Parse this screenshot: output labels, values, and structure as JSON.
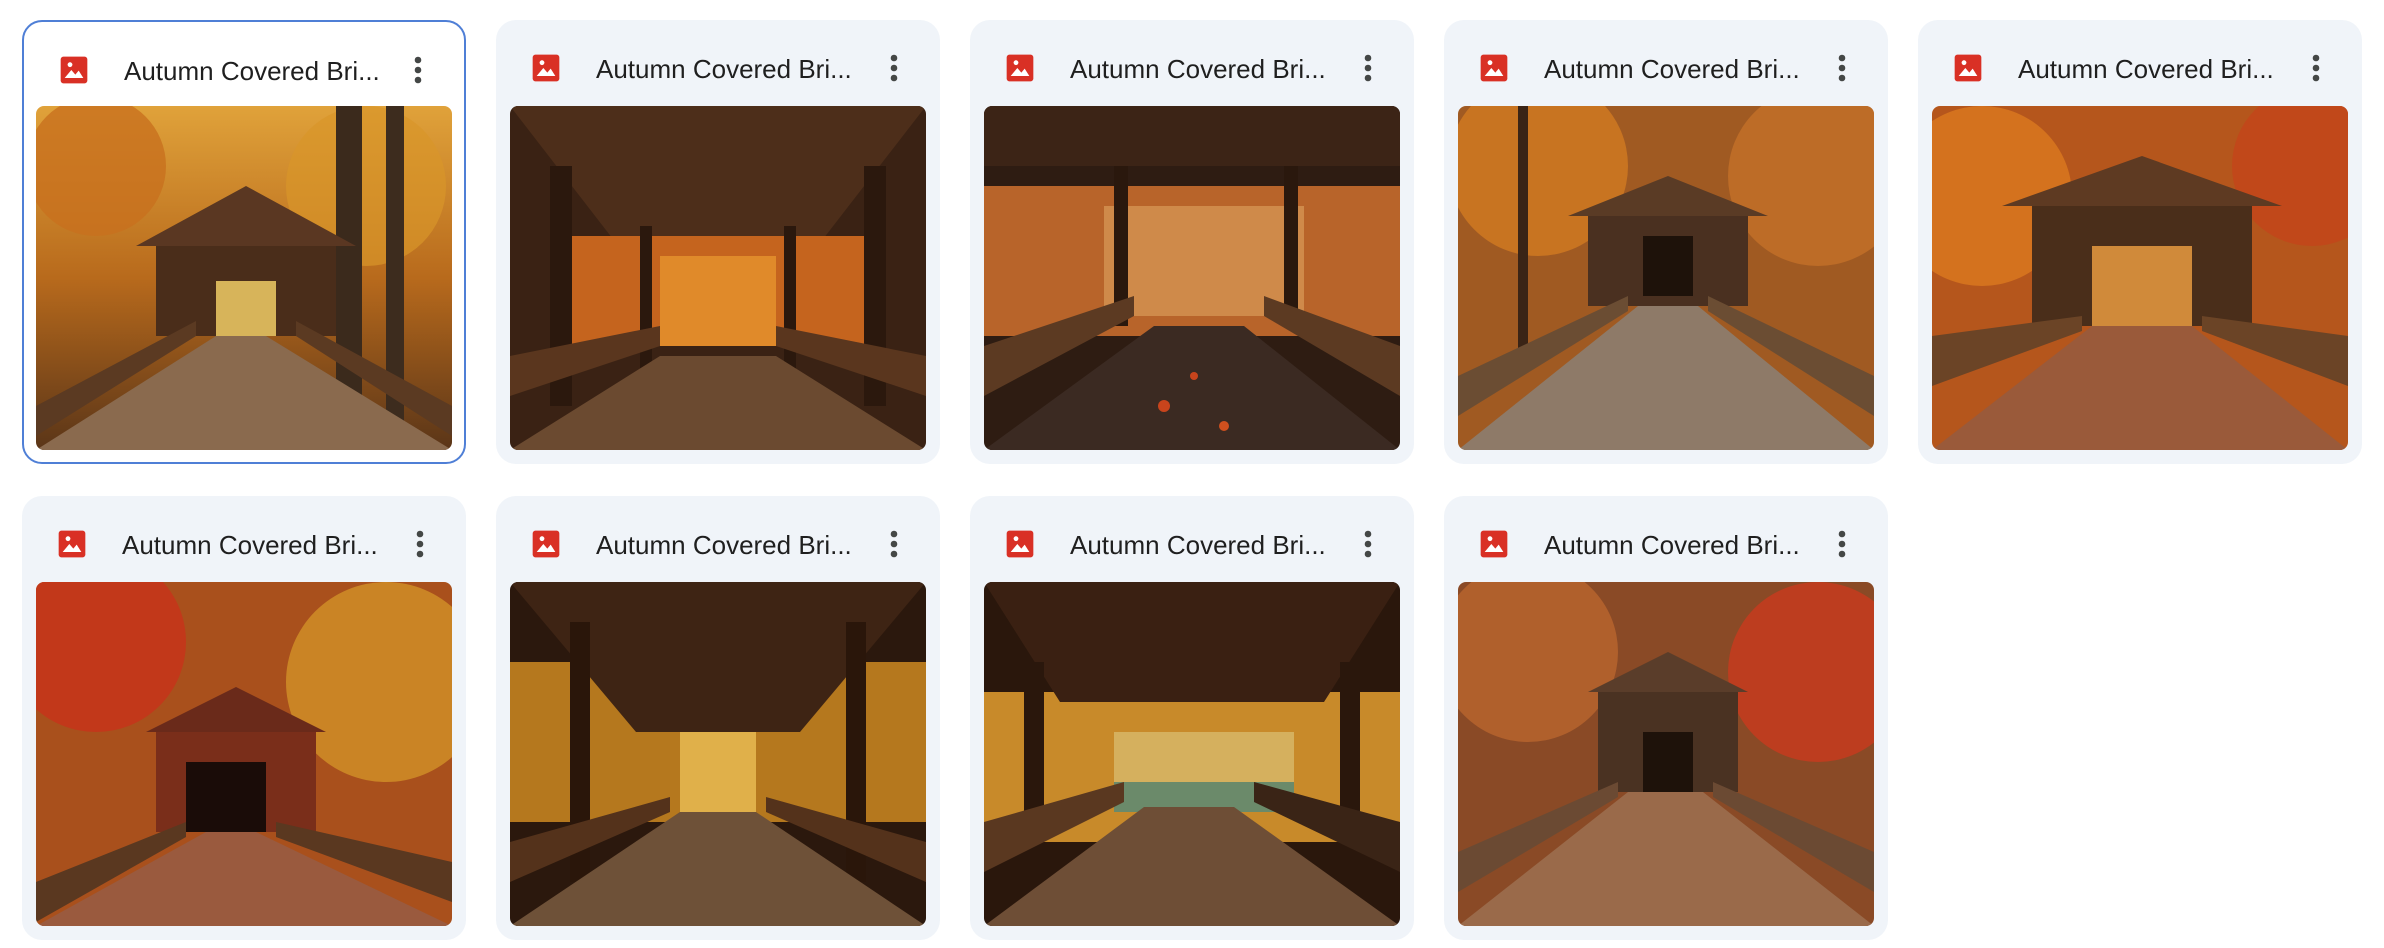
{
  "files": [
    {
      "title": "Autumn Covered Bri...",
      "icon": "image-icon",
      "menu_icon": "more-vert-icon",
      "selected": true,
      "thumb_style": "forest-exterior-bright"
    },
    {
      "title": "Autumn Covered Bri...",
      "icon": "image-icon",
      "menu_icon": "more-vert-icon",
      "selected": false,
      "thumb_style": "interior-dark"
    },
    {
      "title": "Autumn Covered Bri...",
      "icon": "image-icon",
      "menu_icon": "more-vert-icon",
      "selected": false,
      "thumb_style": "interior-rainy"
    },
    {
      "title": "Autumn Covered Bri...",
      "icon": "image-icon",
      "menu_icon": "more-vert-icon",
      "selected": false,
      "thumb_style": "exterior-lattice"
    },
    {
      "title": "Autumn Covered Bri...",
      "icon": "image-icon",
      "menu_icon": "more-vert-icon",
      "selected": false,
      "thumb_style": "exterior-orange"
    },
    {
      "title": "Autumn Covered Bri...",
      "icon": "image-icon",
      "menu_icon": "more-vert-icon",
      "selected": false,
      "thumb_style": "exterior-red-barn"
    },
    {
      "title": "Autumn Covered Bri...",
      "icon": "image-icon",
      "menu_icon": "more-vert-icon",
      "selected": false,
      "thumb_style": "interior-long"
    },
    {
      "title": "Autumn Covered Bri...",
      "icon": "image-icon",
      "menu_icon": "more-vert-icon",
      "selected": false,
      "thumb_style": "interior-river"
    },
    {
      "title": "Autumn Covered Bri...",
      "icon": "image-icon",
      "menu_icon": "more-vert-icon",
      "selected": false,
      "thumb_style": "exterior-painted"
    }
  ],
  "colors": {
    "icon_red": "#d93025",
    "selected_border": "#4f7fd6",
    "card_bg": "#f0f4f9",
    "title_text": "#1f1f1f"
  }
}
